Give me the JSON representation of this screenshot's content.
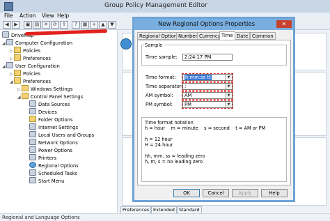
{
  "window": {
    "title": "Group Policy Management Editor"
  },
  "menu": [
    "File",
    "Action",
    "View",
    "Help"
  ],
  "tree": {
    "items": [
      {
        "label": "DriveMap",
        "icon": "gpo-icon"
      },
      {
        "label": "Computer Configuration",
        "icon": "computer-icon"
      },
      {
        "label": "Policies",
        "icon": "folder-icon"
      },
      {
        "label": "Preferences",
        "icon": "folder-icon"
      },
      {
        "label": "User Configuration",
        "icon": "user-icon"
      },
      {
        "label": "Policies",
        "icon": "folder-icon"
      },
      {
        "label": "Preferences",
        "icon": "folder-icon"
      },
      {
        "label": "Windows Settings",
        "icon": "folder-icon"
      },
      {
        "label": "Control Panel Settings",
        "icon": "folder-icon"
      },
      {
        "label": "Data Sources",
        "icon": "data-sources-icon"
      },
      {
        "label": "Devices",
        "icon": "devices-icon"
      },
      {
        "label": "Folder Options",
        "icon": "folder-options-icon"
      },
      {
        "label": "Internet Settings",
        "icon": "internet-icon"
      },
      {
        "label": "Local Users and Groups",
        "icon": "users-icon"
      },
      {
        "label": "Network Options",
        "icon": "network-icon"
      },
      {
        "label": "Power Options",
        "icon": "power-icon"
      },
      {
        "label": "Printers",
        "icon": "printer-icon"
      },
      {
        "label": "Regional Options",
        "icon": "globe-icon"
      },
      {
        "label": "Scheduled Tasks",
        "icon": "tasks-icon"
      },
      {
        "label": "Start Menu",
        "icon": "start-menu-icon"
      }
    ]
  },
  "bottom_tabs": [
    "Preferences",
    "Extended",
    "Standard"
  ],
  "status": "Regional and Language Options",
  "dialog": {
    "title": "New Regional Options Properties",
    "tabs": [
      "Regional Options",
      "Numbers",
      "Currency",
      "Time",
      "Date",
      "Common"
    ],
    "active_tab": "Time",
    "sample_group": "Sample",
    "time_sample_label": "Time sample:",
    "time_sample_value": "2:24:17 PM",
    "time_format_label": "Time format:",
    "time_format_value": "h:mm:ss tt",
    "time_separator_label": "Time separator:",
    "time_separator_value": ":",
    "am_symbol_label": "AM symbol:",
    "am_symbol_value": "AM",
    "pm_symbol_label": "PM symbol:",
    "pm_symbol_value": "PM",
    "notation_title": "Time format notation",
    "notation_line1": "h = hour    m = minute    s = second    t = AM or PM",
    "notation_line2": "h = 12 hour",
    "notation_line3": "H = 24 hour",
    "notation_line4": "hh, mm, ss = leading zero",
    "notation_line5": "h, m, s = no leading zero",
    "buttons": {
      "ok": "OK",
      "cancel": "Cancel",
      "apply": "Apply",
      "help": "Help"
    }
  },
  "colors": {
    "dialog_border": "#6ea3d6",
    "highlight": "#3a78d6",
    "annotation": "#e0211d"
  }
}
